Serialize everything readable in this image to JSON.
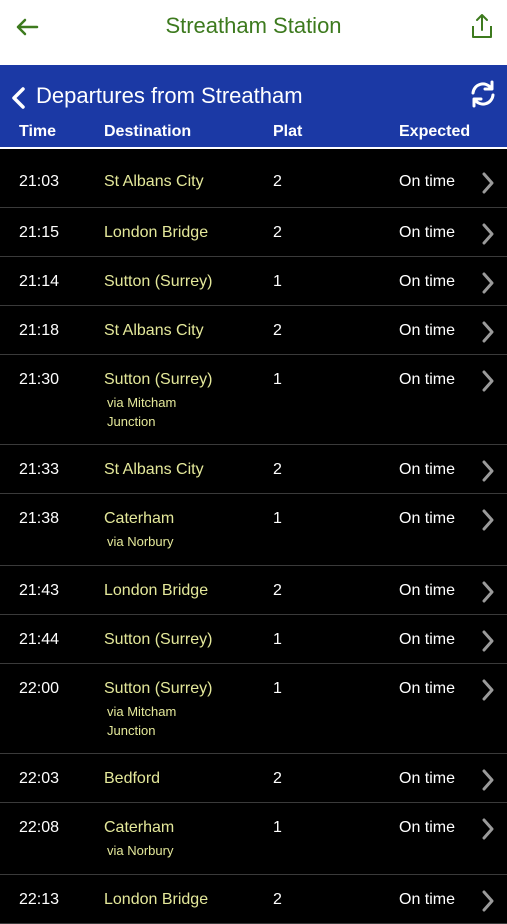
{
  "topbar": {
    "title": "Streatham Station"
  },
  "header": {
    "title": "Departures from Streatham"
  },
  "columns": {
    "time": "Time",
    "destination": "Destination",
    "platform": "Plat",
    "expected": "Expected"
  },
  "departures": [
    {
      "time": "21:03",
      "destination": "St Albans City",
      "via": "",
      "platform": "2",
      "expected": "On time"
    },
    {
      "time": "21:15",
      "destination": "London Bridge",
      "via": "",
      "platform": "2",
      "expected": "On time"
    },
    {
      "time": "21:14",
      "destination": "Sutton (Surrey)",
      "via": "",
      "platform": "1",
      "expected": "On time"
    },
    {
      "time": "21:18",
      "destination": "St Albans City",
      "via": "",
      "platform": "2",
      "expected": "On time"
    },
    {
      "time": "21:30",
      "destination": "Sutton (Surrey)",
      "via": "via Mitcham Junction",
      "platform": "1",
      "expected": "On time"
    },
    {
      "time": "21:33",
      "destination": "St Albans City",
      "via": "",
      "platform": "2",
      "expected": "On time"
    },
    {
      "time": "21:38",
      "destination": "Caterham",
      "via": "via Norbury",
      "platform": "1",
      "expected": "On time"
    },
    {
      "time": "21:43",
      "destination": "London Bridge",
      "via": "",
      "platform": "2",
      "expected": "On time"
    },
    {
      "time": "21:44",
      "destination": "Sutton (Surrey)",
      "via": "",
      "platform": "1",
      "expected": "On time"
    },
    {
      "time": "22:00",
      "destination": "Sutton (Surrey)",
      "via": "via Mitcham Junction",
      "platform": "1",
      "expected": "On time"
    },
    {
      "time": "22:03",
      "destination": "Bedford",
      "via": "",
      "platform": "2",
      "expected": "On time"
    },
    {
      "time": "22:08",
      "destination": "Caterham",
      "via": "via Norbury",
      "platform": "1",
      "expected": "On time"
    },
    {
      "time": "22:13",
      "destination": "London Bridge",
      "via": "",
      "platform": "2",
      "expected": "On time"
    }
  ]
}
